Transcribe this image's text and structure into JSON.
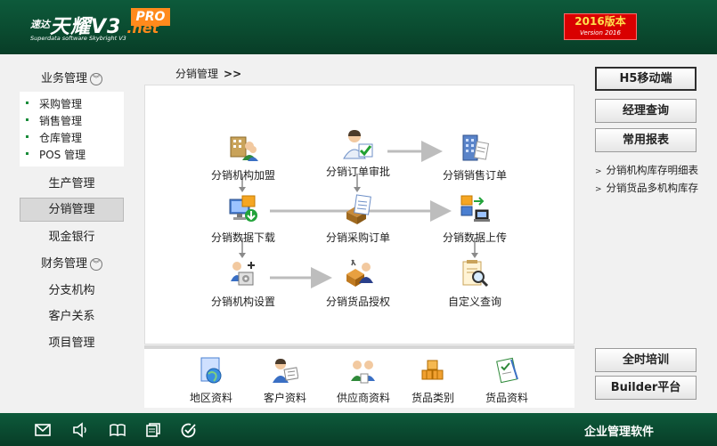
{
  "header": {
    "logo_small": "速达",
    "logo_main": "天耀V3",
    "logo_net": ".net",
    "logo_sub": "Superdata software Skybright V3",
    "pro_badge": "PRO",
    "version_main": "2016版本",
    "version_sub": "Version 2016"
  },
  "sidebar": {
    "business": "业务管理",
    "business_sub": [
      "采购管理",
      "销售管理",
      "仓库管理",
      "POS 管理"
    ],
    "production": "生产管理",
    "distribution": "分销管理",
    "cash": "现金银行",
    "finance": "财务管理",
    "branch": "分支机构",
    "crm": "客户关系",
    "project": "项目管理"
  },
  "breadcrumb": {
    "text": "分销管理",
    "sep": ">>"
  },
  "flow": {
    "join": "分销机构加盟",
    "order_review": "分销订单审批",
    "sales_order": "分销销售订单",
    "data_download": "分销数据下载",
    "purchase_order": "分销采购订单",
    "data_upload": "分销数据上传",
    "org_setup": "分销机构设置",
    "goods_auth": "分销货品授权",
    "custom_query": "自定义查询"
  },
  "quick": {
    "region": "地区资料",
    "customer": "客户资料",
    "supplier": "供应商资料",
    "category": "货品类别",
    "goods": "货品资料"
  },
  "right": {
    "h5": "H5移动端",
    "manager_query": "经理查询",
    "reports": "常用报表",
    "link1": "分销机构库存明细表",
    "link2": "分销货品多机构库存",
    "training": "全时培训",
    "builder": "Builder平台"
  },
  "footer": {
    "brand": "企业管理软件"
  },
  "colors": {
    "header_green": "#0a4a2f",
    "accent_orange": "#ff8a1c",
    "version_red": "#d90000"
  }
}
